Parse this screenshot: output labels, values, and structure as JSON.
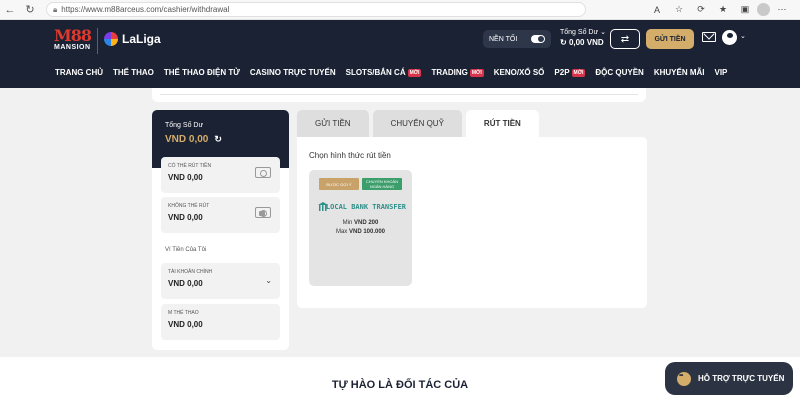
{
  "browser": {
    "url": "https://www.m88arceus.com/cashier/withdrawal"
  },
  "header": {
    "logo_top": "M88",
    "logo_bottom": "MANSION",
    "partner_logo": "LaLiga",
    "night_mode_label": "NỀN TỐI",
    "balance_label": "Tổng Số Dư",
    "balance_value": "0,00 VND",
    "deposit_button": "GỬI TIỀN",
    "nav": [
      {
        "label": "TRANG CHỦ",
        "badge": ""
      },
      {
        "label": "THỂ THAO",
        "badge": ""
      },
      {
        "label": "THỂ THAO ĐIỆN TỬ",
        "badge": ""
      },
      {
        "label": "CASINO TRỰC TUYẾN",
        "badge": ""
      },
      {
        "label": "SLOTS/BẮN CÁ",
        "badge": "MỚI"
      },
      {
        "label": "TRADING",
        "badge": "MỚI"
      },
      {
        "label": "KENO/XỔ SỐ",
        "badge": ""
      },
      {
        "label": "P2P",
        "badge": "MỚI"
      },
      {
        "label": "ĐỘC QUYỀN",
        "badge": ""
      },
      {
        "label": "KHUYẾN MÃI",
        "badge": ""
      },
      {
        "label": "VIP",
        "badge": ""
      }
    ]
  },
  "sidebar": {
    "total_label": "Tổng Số Dư",
    "total_value": "VND 0,00",
    "withdrawable_label": "CÓ THỂ RÚT TIỀN",
    "withdrawable_value": "VND 0,00",
    "non_withdrawable_label": "KHÔNG THỂ RÚT",
    "non_withdrawable_value": "VND 0,00",
    "wallet_title": "Ví Tiền Của Tôi",
    "main_account_label": "TÀI KHOẢN CHÍNH",
    "main_account_value": "VND 0,00",
    "sports_wallet_label": "M THỂ THAO",
    "sports_wallet_value": "VND 0,00"
  },
  "cashier": {
    "tabs": [
      "GỬI TIỀN",
      "CHUYỂN QUỸ",
      "RÚT TIỀN"
    ],
    "active_tab": "RÚT TIỀN",
    "choose_title": "Chọn hình thức rút tiền",
    "method": {
      "tag_recommended": "ĐƯỢC GỢI Ý",
      "tag_bank": "CHUYỂN KHOẢN NGÂN HÀNG",
      "name": "LOCAL BANK TRANSFER",
      "min_label": "Min",
      "min_value": "VND 200",
      "max_label": "Max",
      "max_value": "VND 100.000"
    }
  },
  "footer": {
    "partner_title": "TỰ HÀO LÀ ĐỐI TÁC CỦA",
    "support_button": "HỖ TRỢ TRỰC TUYẾN"
  },
  "colors": {
    "header_bg": "#1b2233",
    "gold": "#d4ad6a",
    "badge_red": "#d8354a",
    "bank_green": "#3c9e6b"
  }
}
